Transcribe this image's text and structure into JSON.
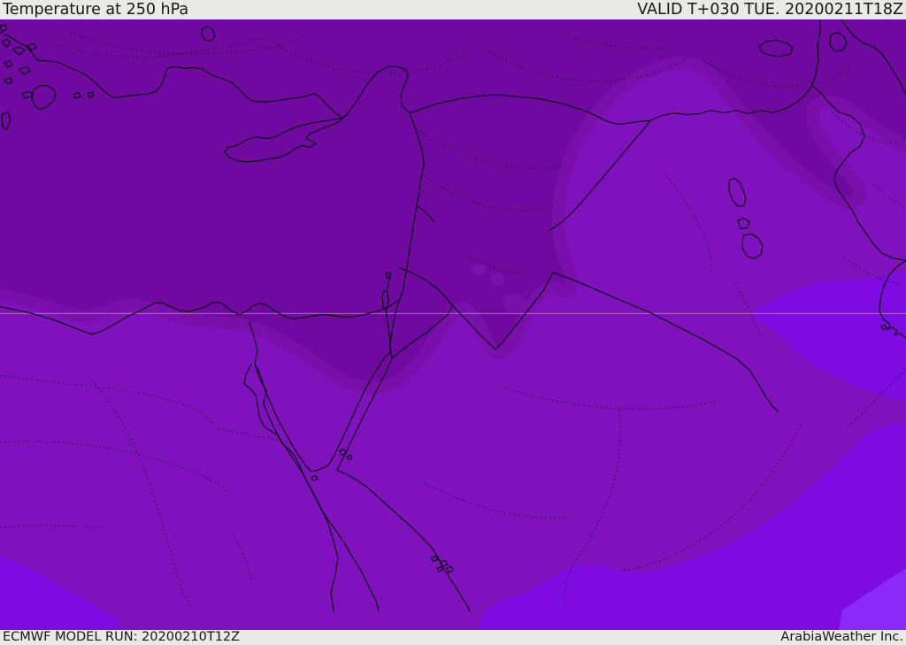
{
  "header": {
    "title": "Temperature at 250 hPa",
    "valid_label": "VALID T+030 TUE. 20200211T18Z"
  },
  "footer": {
    "model_run": "ECMWF MODEL RUN: 20200210T12Z",
    "credit": "ArabiaWeather Inc."
  },
  "colors": {
    "band1": "#6f099f",
    "band2": "#7a10ac",
    "band3": "#7f12bc",
    "band4": "#7d0be2",
    "band5": "#8b2bfa",
    "coastline": "#0a0a12",
    "admin_boundary": "#1c0a20",
    "gridline": "#e2d4ee",
    "bar_bg": "#e9e9e7",
    "bar_text": "#161616"
  }
}
